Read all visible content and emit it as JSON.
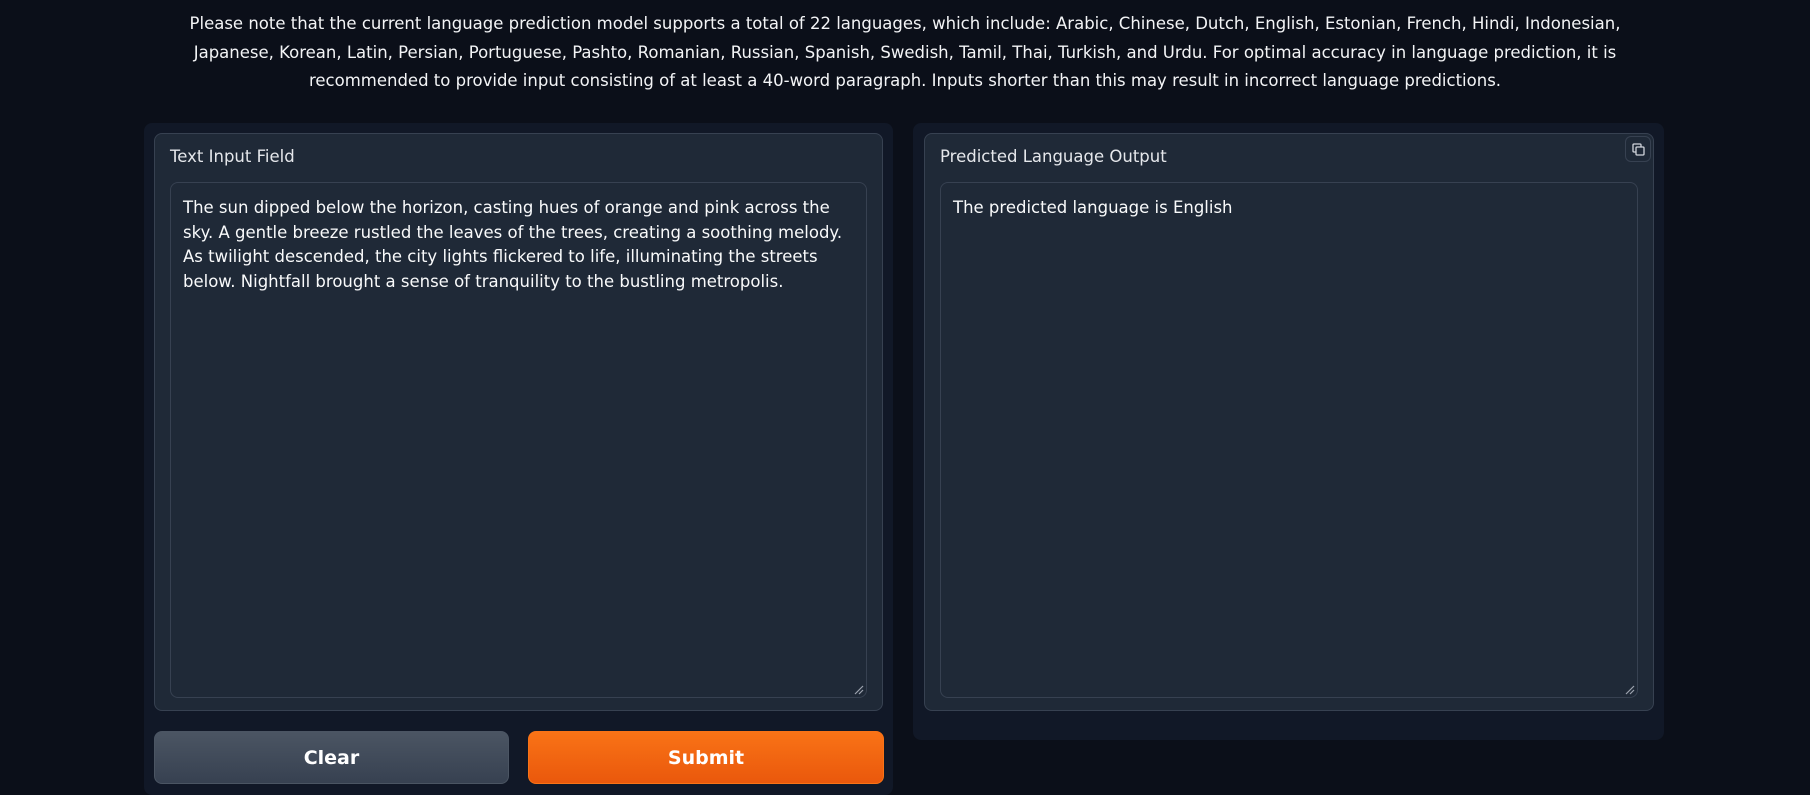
{
  "notice": {
    "text": "Please note that the current language prediction model supports a total of 22 languages, which include: Arabic, Chinese, Dutch, English, Estonian, French, Hindi, Indonesian, Japanese, Korean, Latin, Persian, Portuguese, Pashto, Romanian, Russian, Spanish, Swedish, Tamil, Thai, Turkish, and Urdu. For optimal accuracy in language prediction, it is recommended to provide input consisting of at least a 40-word paragraph. Inputs shorter than this may result in incorrect language predictions."
  },
  "input": {
    "label": "Text Input Field",
    "value": "The sun dipped below the horizon, casting hues of orange and pink across the sky. A gentle breeze rustled the leaves of the trees, creating a soothing melody. As twilight descended, the city lights flickered to life, illuminating the streets below. Nightfall brought a sense of tranquility to the bustling metropolis."
  },
  "output": {
    "label": "Predicted Language Output",
    "value": "The predicted language is English",
    "copy_icon": "copy-icon"
  },
  "buttons": {
    "clear_label": "Clear",
    "submit_label": "Submit"
  },
  "colors": {
    "background": "#0b0f19",
    "panel": "#111827",
    "block": "#1f2937",
    "border": "#374151",
    "accent": "#f97316",
    "secondary_button": "#4b5563"
  }
}
